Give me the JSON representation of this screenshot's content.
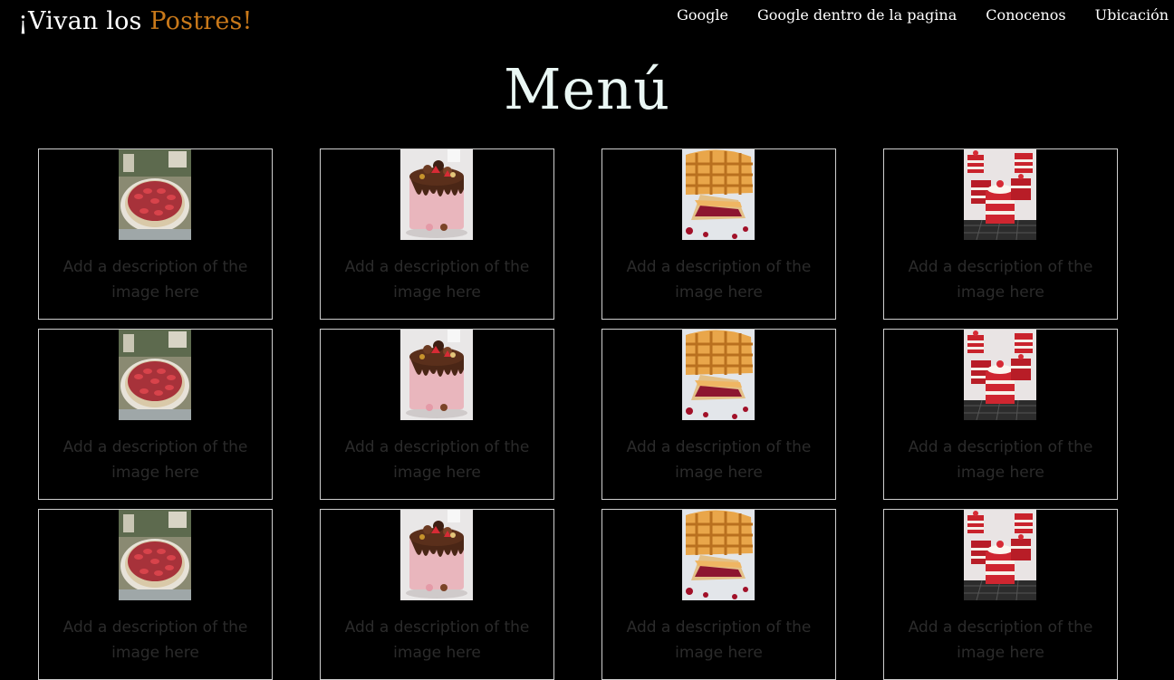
{
  "site": {
    "logo_prefix": "¡Vivan los ",
    "logo_accent": "Postres!",
    "accent_color": "#c9791a"
  },
  "nav": {
    "items": [
      {
        "label": "Google"
      },
      {
        "label": "Google dentro de la pagina"
      },
      {
        "label": "Conocenos"
      },
      {
        "label": "Ubicación"
      }
    ]
  },
  "page": {
    "title": "Menú"
  },
  "cards": [
    {
      "image": "strawberry-cheesecake",
      "description": "Add a description of the image here"
    },
    {
      "image": "chocolate-drip-cake",
      "description": "Add a description of the image here"
    },
    {
      "image": "lattice-cherry-pie",
      "description": "Add a description of the image here"
    },
    {
      "image": "red-velvet-mini-cakes",
      "description": "Add a description of the image here"
    },
    {
      "image": "strawberry-cheesecake",
      "description": "Add a description of the image here"
    },
    {
      "image": "chocolate-drip-cake",
      "description": "Add a description of the image here"
    },
    {
      "image": "lattice-cherry-pie",
      "description": "Add a description of the image here"
    },
    {
      "image": "red-velvet-mini-cakes",
      "description": "Add a description of the image here"
    },
    {
      "image": "strawberry-cheesecake",
      "description": "Add a description of the image here"
    },
    {
      "image": "chocolate-drip-cake",
      "description": "Add a description of the image here"
    },
    {
      "image": "lattice-cherry-pie",
      "description": "Add a description of the image here"
    },
    {
      "image": "red-velvet-mini-cakes",
      "description": "Add a description of the image here"
    }
  ]
}
